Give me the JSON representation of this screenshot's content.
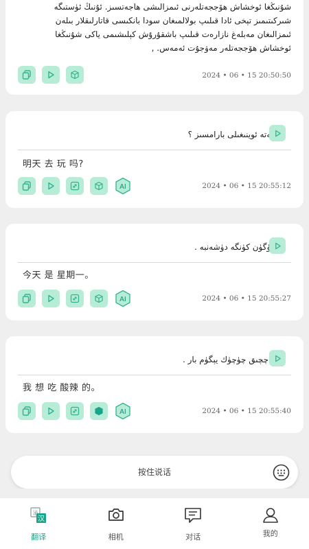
{
  "cards": [
    {
      "target_text": "شۇنىڭغا ئوخشاش ھۆججەتلەرنى ئىمزالىشى ھاجەتسىز. ئۇنىڭ ئۈستىگە شىركىتىمىز تېخى ئادا قىلىپ بولالمىغان سودا بانكىسى قاتارلىقلار بىلەن ئىمزالىغان مەبلەغ نازارەت قىلىپ باشقۇرۇش كېلىشىمى ياكى شۇنىڭغا ئوخشاش ھۆججەتلەر مەۋجۇت ئەمەس. ,",
      "time": "2024 • 06 • 15 20:50:50"
    },
    {
      "target_text": "ئەتە ئوينىغىلى بارامسىز ؟",
      "source_text": "明天 去 玩 吗?",
      "time": "2024 • 06 • 15 20:55:12"
    },
    {
      "target_text": "بۈگۈن كۈنگە دۈشەنبە .",
      "source_text": "今天 是 星期一。",
      "time": "2024 • 06 • 15 20:55:27"
    },
    {
      "target_text": "ئاچچىق چۈچۈك يېگۈم بار .",
      "source_text": "我 想 吃 酸辣 的。",
      "time": "2024 • 06 • 15 20:55:40"
    }
  ],
  "ai_label": "AI",
  "input_bar": {
    "hint": "按住说话"
  },
  "tabs": [
    {
      "label": "翻译",
      "icon": "translate-icon",
      "active": true
    },
    {
      "label": "相机",
      "icon": "camera-icon"
    },
    {
      "label": "对话",
      "icon": "chat-icon"
    },
    {
      "label": "我的",
      "icon": "user-icon"
    }
  ],
  "translate_icon_chars": {
    "top": "🔲",
    "bottom": "汉"
  },
  "colors": {
    "accent": "#1aa58a",
    "icon_bg": "#b7ecd6",
    "icon_stroke": "#2fb391",
    "background": "#efefef"
  }
}
